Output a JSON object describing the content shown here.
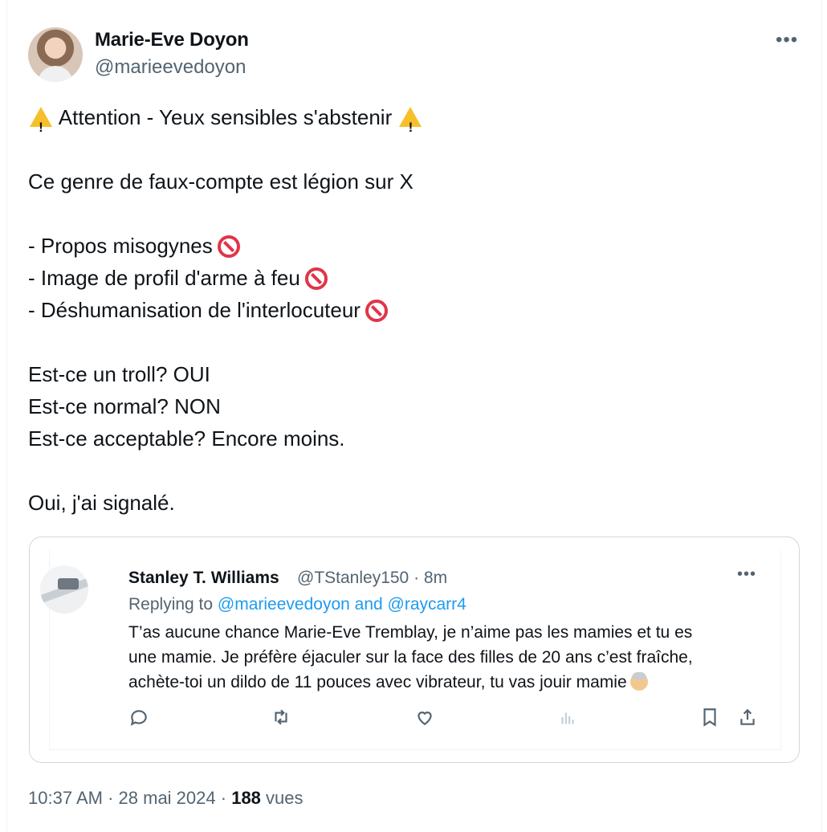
{
  "tweet": {
    "author": {
      "name": "Marie-Eve Doyon",
      "handle": "@marieevedoyon"
    },
    "more_icon": "more-horizontal-icon",
    "lines": [
      "Attention - Yeux sensibles s'abstenir",
      "Ce genre de faux-compte est légion sur X",
      "- Propos misogynes",
      "- Image de profil d'arme à feu",
      "- Déshumanisation de l'interlocuteur",
      "Est-ce un troll? OUI",
      "Est-ce normal? NON",
      "Est-ce acceptable? Encore moins.",
      "Oui, j'ai signalé."
    ],
    "emoji": {
      "warning": "warning-icon",
      "prohibited": "no-entry-icon"
    },
    "footer": {
      "time": "10:37 AM",
      "sep": "·",
      "date": "28 mai 2024",
      "views_count": "188",
      "views_label": "vues"
    }
  },
  "quoted": {
    "author": {
      "name": "Stanley T. Williams",
      "handle": "@TStanley150",
      "time": "· 8m"
    },
    "reply_prefix": "Replying to",
    "reply_mentions": "@marieevedoyon and @raycarr4",
    "text_lines": [
      "T’as aucune chance Marie-Eve Tremblay, je n’aime pas les mamies et tu es",
      "une mamie. Je préfère éjaculer sur la face des filles de 20 ans c’est fraîche,",
      "achète-toi un dildo de 11 pouces avec vibrateur, tu vas jouir mamie"
    ],
    "actions": [
      "reply-icon",
      "retweet-icon",
      "like-icon",
      "views-icon",
      "bookmark-icon",
      "share-icon"
    ]
  }
}
